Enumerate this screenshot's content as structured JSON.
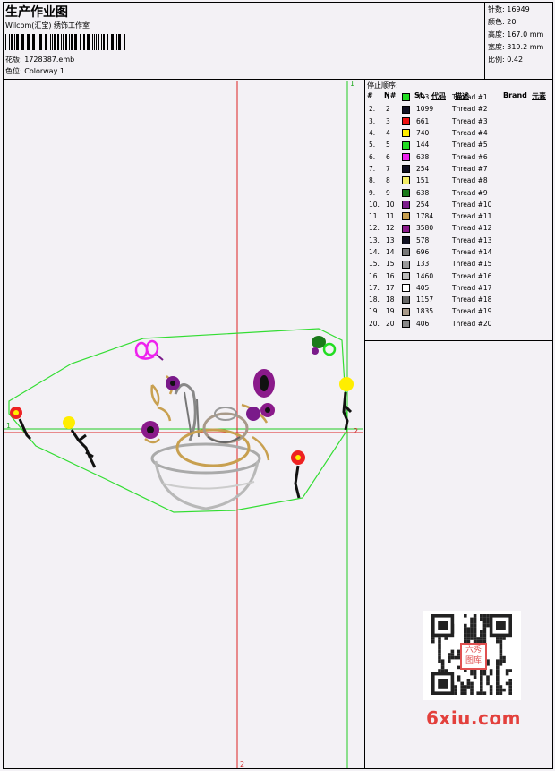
{
  "header": {
    "title": "生产作业图",
    "company": "Wilcom(汇宝) 绣饰工作室",
    "design_label": "花版:",
    "design_value": "1728387.emb",
    "colorway_label": "色位:",
    "colorway_value": "Colorway 1"
  },
  "stats": [
    {
      "label": "针数:",
      "value": "16949"
    },
    {
      "label": "颜色:",
      "value": "20"
    },
    {
      "label": "高度:",
      "value": "167.0 mm"
    },
    {
      "label": "宽度:",
      "value": "319.2 mm"
    },
    {
      "label": "比例:",
      "value": "0.42"
    }
  ],
  "stop_sequence": {
    "title": "停止顺序:",
    "columns": {
      "num": "#",
      "n": "N#",
      "st": "St.",
      "code": "代码",
      "desc": "描述",
      "brand": "Brand",
      "element": "元素"
    },
    "rows": [
      {
        "num": "1.",
        "n": "1",
        "color": "#22dd22",
        "st": "333",
        "desc": "Thread #1"
      },
      {
        "num": "2.",
        "n": "2",
        "color": "#111122",
        "st": "1099",
        "desc": "Thread #2"
      },
      {
        "num": "3.",
        "n": "3",
        "color": "#ee1111",
        "st": "661",
        "desc": "Thread #3"
      },
      {
        "num": "4.",
        "n": "4",
        "color": "#ffee00",
        "st": "740",
        "desc": "Thread #4"
      },
      {
        "num": "5.",
        "n": "5",
        "color": "#22dd22",
        "st": "144",
        "desc": "Thread #5"
      },
      {
        "num": "6.",
        "n": "6",
        "color": "#ee22ee",
        "st": "638",
        "desc": "Thread #6"
      },
      {
        "num": "7.",
        "n": "7",
        "color": "#111122",
        "st": "254",
        "desc": "Thread #7"
      },
      {
        "num": "8.",
        "n": "8",
        "color": "#f4ee66",
        "st": "151",
        "desc": "Thread #8"
      },
      {
        "num": "9.",
        "n": "9",
        "color": "#1a7a1a",
        "st": "638",
        "desc": "Thread #9"
      },
      {
        "num": "10.",
        "n": "10",
        "color": "#7a1a8a",
        "st": "254",
        "desc": "Thread #10"
      },
      {
        "num": "11.",
        "n": "11",
        "color": "#c8a050",
        "st": "1784",
        "desc": "Thread #11"
      },
      {
        "num": "12.",
        "n": "12",
        "color": "#8a1a8a",
        "st": "3580",
        "desc": "Thread #12"
      },
      {
        "num": "13.",
        "n": "13",
        "color": "#111122",
        "st": "578",
        "desc": "Thread #13"
      },
      {
        "num": "14.",
        "n": "14",
        "color": "#777777",
        "st": "696",
        "desc": "Thread #14"
      },
      {
        "num": "15.",
        "n": "15",
        "color": "#999999",
        "st": "133",
        "desc": "Thread #15"
      },
      {
        "num": "16.",
        "n": "16",
        "color": "#bbbbbb",
        "st": "1460",
        "desc": "Thread #16"
      },
      {
        "num": "17.",
        "n": "17",
        "color": "#ffffff",
        "st": "405",
        "desc": "Thread #17"
      },
      {
        "num": "18.",
        "n": "18",
        "color": "#666666",
        "st": "1157",
        "desc": "Thread #18"
      },
      {
        "num": "19.",
        "n": "19",
        "color": "#a89a8a",
        "st": "1835",
        "desc": "Thread #19"
      },
      {
        "num": "20.",
        "n": "20",
        "color": "#888888",
        "st": "406",
        "desc": "Thread #20"
      }
    ]
  },
  "axis_labels": {
    "top": "1",
    "bottom": "2",
    "left": "1",
    "right": "2"
  },
  "watermark": "6xiu.com",
  "qr_stamp": "六秀图库"
}
